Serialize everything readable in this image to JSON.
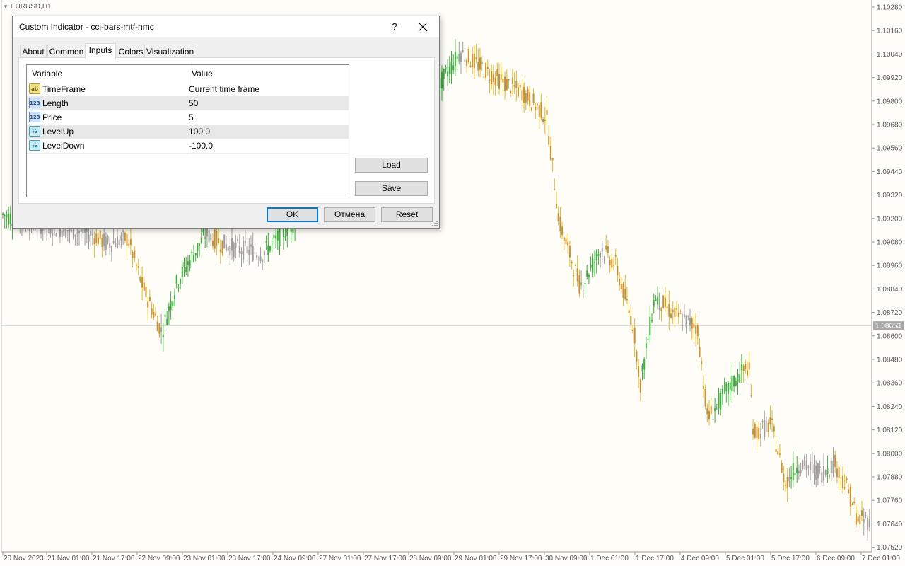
{
  "chart": {
    "symbol": "EURUSD,H1",
    "price_labels": [
      "1.10280",
      "1.10160",
      "1.10040",
      "1.09920",
      "1.09800",
      "1.09680",
      "1.09560",
      "1.09440",
      "1.09320",
      "1.09200",
      "1.09080",
      "1.08960",
      "1.08840",
      "1.08720",
      "1.08600",
      "1.08480",
      "1.08360",
      "1.08240",
      "1.08120",
      "1.08000",
      "1.07880",
      "1.07760",
      "1.07640",
      "1.07520"
    ],
    "current_price": "1.08653",
    "time_labels": [
      "20 Nov 2023",
      "21 Nov 01:00",
      "21 Nov 17:00",
      "22 Nov 09:00",
      "23 Nov 01:00",
      "23 Nov 17:00",
      "24 Nov 09:00",
      "27 Nov 01:00",
      "27 Nov 17:00",
      "28 Nov 09:00",
      "29 Nov 01:00",
      "29 Nov 17:00",
      "30 Nov 09:00",
      "1 Dec 01:00",
      "1 Dec 17:00",
      "4 Dec 09:00",
      "5 Dec 01:00",
      "5 Dec 17:00",
      "6 Dec 09:00",
      "7 Dec 01:00"
    ],
    "colors": {
      "bull": "#3dad3d",
      "neutral": "#9e9e9e",
      "bear": "#c8912f",
      "bear_wick": "#e3b62a",
      "axis_text": "#555555",
      "price_tag_bg": "#a8a8a8"
    }
  },
  "dialog": {
    "title": "Custom Indicator - cci-bars-mtf-nmc",
    "help": "?",
    "tabs": [
      "About",
      "Common",
      "Inputs",
      "Colors",
      "Visualization"
    ],
    "active_tab": "Inputs",
    "columns": {
      "variable": "Variable",
      "value": "Value"
    },
    "params": [
      {
        "icon": "string-type-icon",
        "icon_text": "ab",
        "name": "TimeFrame",
        "value": "Current time frame"
      },
      {
        "icon": "integer-type-icon",
        "icon_text": "123",
        "name": "Length",
        "value": "50"
      },
      {
        "icon": "integer-type-icon",
        "icon_text": "123",
        "name": "Price",
        "value": "5"
      },
      {
        "icon": "double-type-icon",
        "icon_text": "½",
        "name": "LevelUp",
        "value": "100.0"
      },
      {
        "icon": "double-type-icon",
        "icon_text": "½",
        "name": "LevelDown",
        "value": "-100.0"
      }
    ],
    "load": "Load",
    "save": "Save",
    "ok": "OK",
    "cancel": "Отмена",
    "reset": "Reset"
  }
}
